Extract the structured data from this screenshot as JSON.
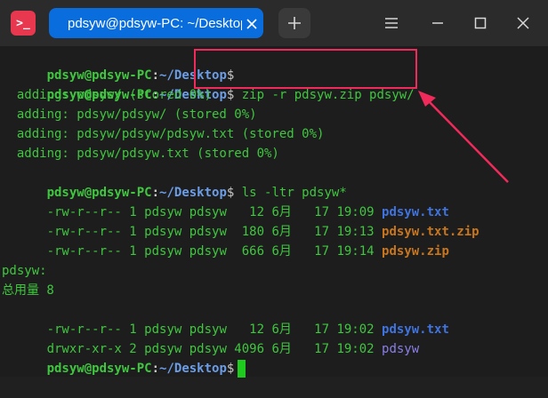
{
  "window": {
    "app_icon_glyph": ">_",
    "tab_title": "pdsyw@pdsyw-PC: ~/Desktop",
    "new_tab_glyph": "+",
    "colors": {
      "tab_active": "#0a6dde",
      "app_icon": "#e8384f",
      "prompt_green": "#3fc73f",
      "path_blue": "#6c9ee8",
      "annotation_red": "#f02a5a"
    }
  },
  "terminal": {
    "prompt": {
      "user": "pdsyw@pdsyw-PC",
      "sep": ":",
      "path": "~/Desktop",
      "dollar": "$"
    },
    "commands": {
      "zip": " zip -r pdsyw.zip pdsyw/",
      "ls": " ls -ltr pdsyw*"
    },
    "zip_output": [
      "  adding: pdsyw/ (stored 0%)",
      "  adding: pdsyw/pdsyw/ (stored 0%)",
      "  adding: pdsyw/pdsyw/pdsyw.txt (stored 0%)",
      "  adding: pdsyw/pdsyw.txt (stored 0%)"
    ],
    "ls_files": [
      {
        "meta": "-rw-r--r-- 1 pdsyw pdsyw   12 6月   17 19:09 ",
        "name": "pdsyw.txt"
      },
      {
        "meta": "-rw-r--r-- 1 pdsyw pdsyw  180 6月   17 19:13 ",
        "name": "pdsyw.txt.zip"
      },
      {
        "meta": "-rw-r--r-- 1 pdsyw pdsyw  666 6月   17 19:14 ",
        "name": "pdsyw.zip"
      }
    ],
    "dir_header": "pdsyw:",
    "total": "总用量 8",
    "dir_files": [
      {
        "meta": "-rw-r--r-- 1 pdsyw pdsyw   12 6月   17 19:02 ",
        "name": "pdsyw.txt"
      },
      {
        "meta": "drwxr-xr-x 2 pdsyw pdsyw 4096 6月   17 19:02 ",
        "name": "pdsyw"
      }
    ]
  }
}
